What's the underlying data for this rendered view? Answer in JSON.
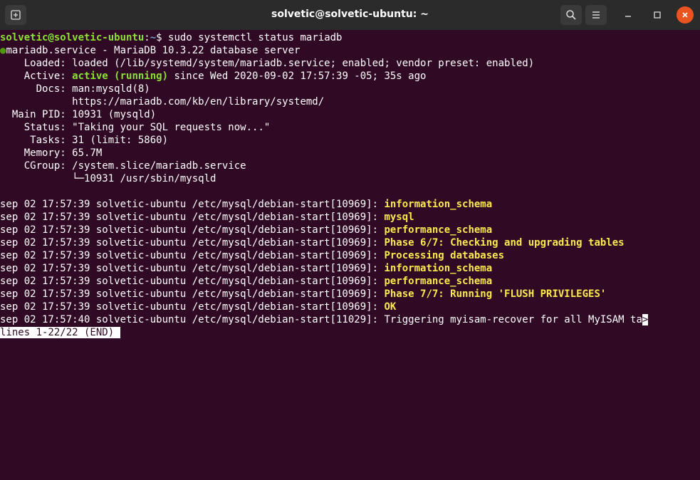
{
  "window": {
    "title": "solvetic@solvetic-ubuntu: ~",
    "buttons": {
      "new_tab": "new-tab-icon",
      "search": "search-icon",
      "menu": "hamburger-menu-icon",
      "minimize": "minimize-icon",
      "maximize": "maximize-icon",
      "close": "close-icon"
    }
  },
  "prompt": {
    "user_host": "solvetic@solvetic-ubuntu",
    "path": "~",
    "symbol": "$",
    "command": "sudo systemctl status mariadb"
  },
  "status": {
    "bullet": "●",
    "unit_line": "mariadb.service - MariaDB 10.3.22 database server",
    "loaded_label": "    Loaded: ",
    "loaded_value": "loaded (/lib/systemd/system/mariadb.service; enabled; vendor preset: enabled)",
    "active_label": "    Active: ",
    "active_state": "active (running)",
    "active_since": " since Wed 2020-09-02 17:57:39 -05; 35s ago",
    "docs_label": "      Docs: ",
    "docs_1": "man:mysqld(8)",
    "docs_2_indent": "            ",
    "docs_2": "https://mariadb.com/kb/en/library/systemd/",
    "mainpid_label": "  Main PID: ",
    "mainpid_value": "10931 (mysqld)",
    "status_label": "    Status: ",
    "status_value": "\"Taking your SQL requests now...\"",
    "tasks_label": "     Tasks: ",
    "tasks_value": "31 (limit: 5860)",
    "memory_label": "    Memory: ",
    "memory_value": "65.7M",
    "cgroup_label": "    CGroup: ",
    "cgroup_value": "/system.slice/mariadb.service",
    "cgroup_child_indent": "            ",
    "cgroup_child": "└─10931 /usr/sbin/mysqld"
  },
  "log": [
    {
      "prefix": "sep 02 17:57:39 solvetic-ubuntu /etc/mysql/debian-start[10969]: ",
      "message": "information_schema",
      "highlight": true
    },
    {
      "prefix": "sep 02 17:57:39 solvetic-ubuntu /etc/mysql/debian-start[10969]: ",
      "message": "mysql",
      "highlight": true
    },
    {
      "prefix": "sep 02 17:57:39 solvetic-ubuntu /etc/mysql/debian-start[10969]: ",
      "message": "performance_schema",
      "highlight": true
    },
    {
      "prefix": "sep 02 17:57:39 solvetic-ubuntu /etc/mysql/debian-start[10969]: ",
      "message": "Phase 6/7: Checking and upgrading tables",
      "highlight": true
    },
    {
      "prefix": "sep 02 17:57:39 solvetic-ubuntu /etc/mysql/debian-start[10969]: ",
      "message": "Processing databases",
      "highlight": true
    },
    {
      "prefix": "sep 02 17:57:39 solvetic-ubuntu /etc/mysql/debian-start[10969]: ",
      "message": "information_schema",
      "highlight": true
    },
    {
      "prefix": "sep 02 17:57:39 solvetic-ubuntu /etc/mysql/debian-start[10969]: ",
      "message": "performance_schema",
      "highlight": true
    },
    {
      "prefix": "sep 02 17:57:39 solvetic-ubuntu /etc/mysql/debian-start[10969]: ",
      "message": "Phase 7/7: Running 'FLUSH PRIVILEGES'",
      "highlight": true
    },
    {
      "prefix": "sep 02 17:57:39 solvetic-ubuntu /etc/mysql/debian-start[10969]: ",
      "message": "OK",
      "highlight": true
    },
    {
      "prefix": "sep 02 17:57:40 solvetic-ubuntu /etc/mysql/debian-start[11029]: ",
      "message": "Triggering myisam-recover for all MyISAM ta",
      "highlight": false,
      "truncation_marker": ">"
    }
  ],
  "pager": {
    "text": "lines 1-22/22 (END)"
  },
  "colors": {
    "background": "#300a24",
    "titlebar": "#2b2b2b",
    "prompt_user": "#8ae234",
    "prompt_path": "#729fcf",
    "active_state": "#8ae234",
    "log_highlight": "#fce94f",
    "bullet": "#4e9a06",
    "close_button": "#e95420"
  }
}
